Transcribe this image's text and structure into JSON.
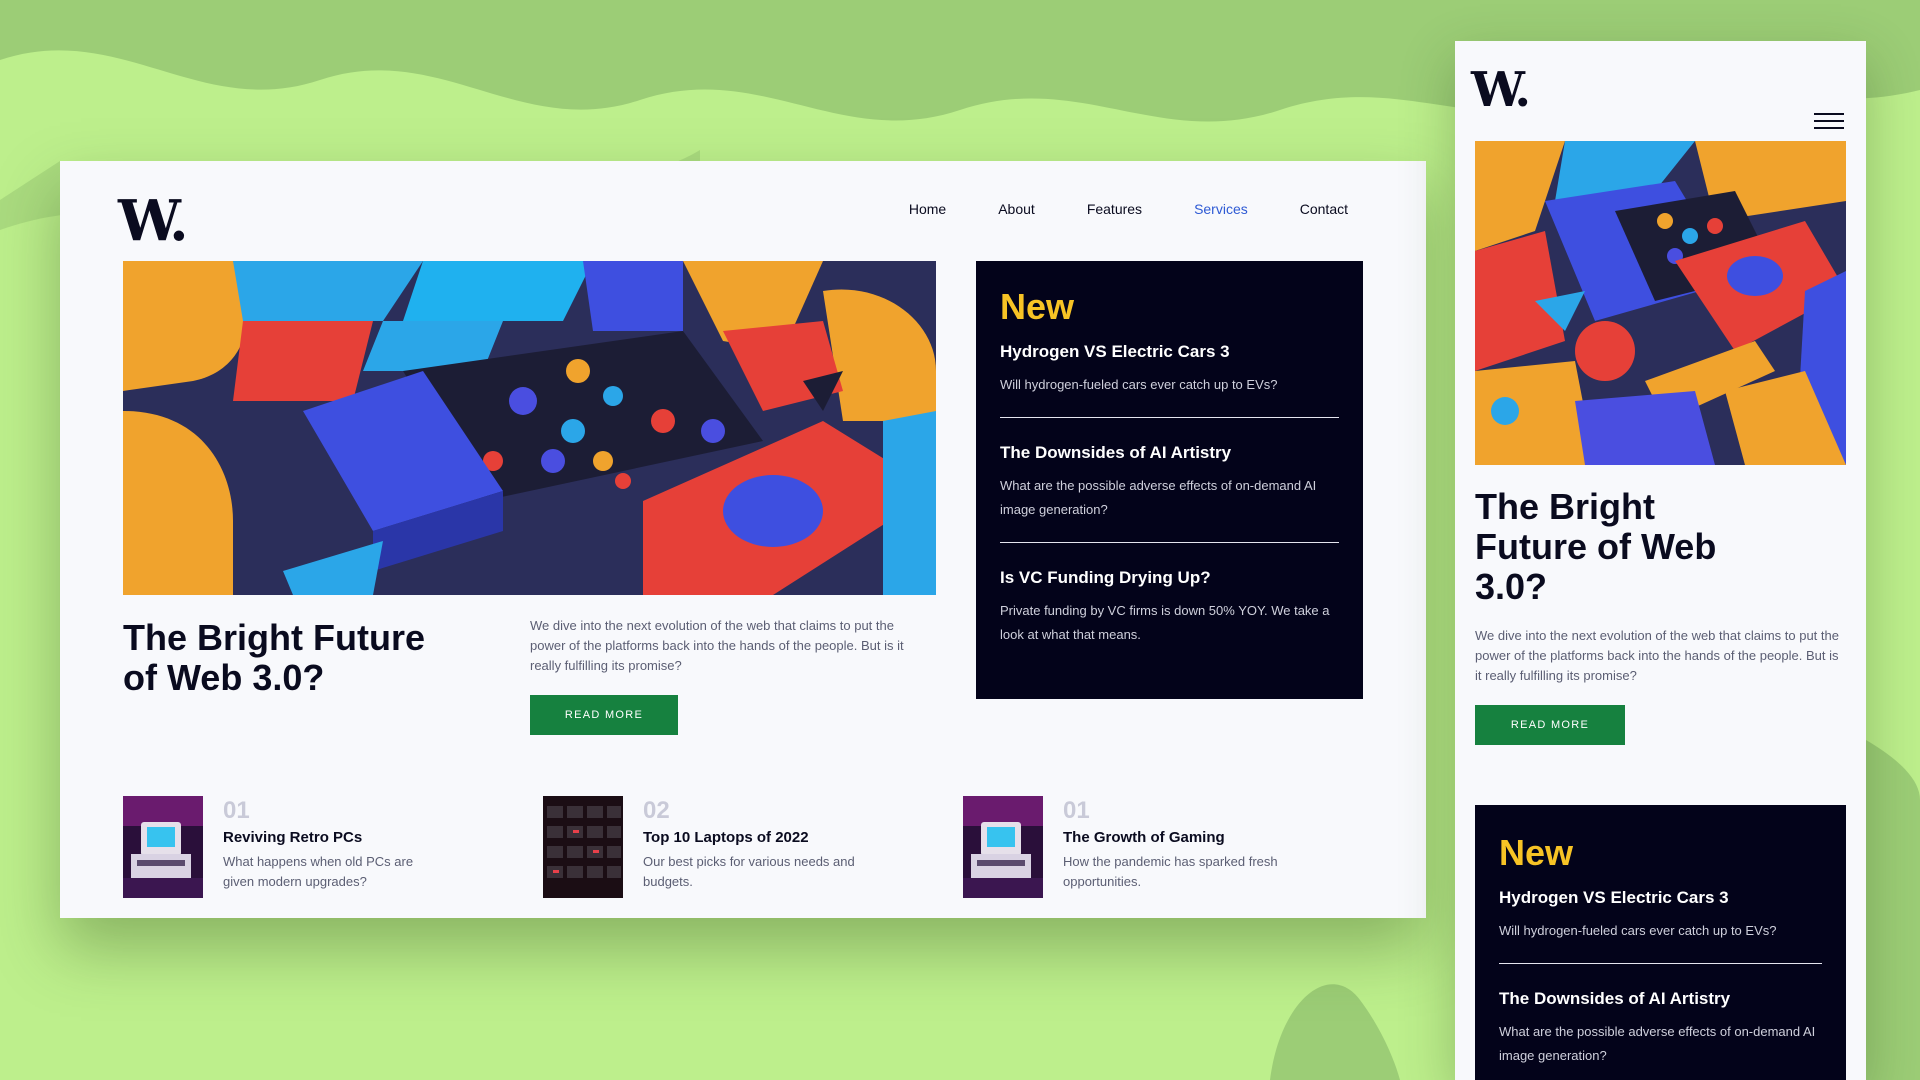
{
  "colors": {
    "background": "#bdef8c",
    "background_waves": "#9ccd76",
    "page": "#f8f9fc",
    "dark": "#0a0b1f",
    "panel": "#03031a",
    "accent_yellow": "#f7c325",
    "button_green": "#16813f",
    "active_link": "#2e5ad4"
  },
  "brand": {
    "logo": "W."
  },
  "nav": {
    "items": [
      "Home",
      "About",
      "Features",
      "Services",
      "Contact"
    ],
    "active": "Services"
  },
  "hero": {
    "title": "The Bright Future of Web 3.0?",
    "description": "We dive into the next evolution of the web that claims to put the power of the platforms back into the hands of the people. But is it really fulfilling its promise?",
    "button": "READ MORE"
  },
  "new_panel": {
    "heading": "New",
    "items": [
      {
        "title": "Hydrogen VS Electric Cars 3",
        "desc": "Will hydrogen-fueled cars ever catch up to EVs?"
      },
      {
        "title": "The Downsides of AI Artistry",
        "desc": "What are the possible adverse effects of on-demand AI image generation?"
      },
      {
        "title": "Is VC Funding Drying Up?",
        "desc": "Private funding by VC firms is down 50% YOY. We take a look at what that means."
      }
    ]
  },
  "articles": [
    {
      "num": "01",
      "title": "Reviving Retro PCs",
      "desc": "What happens when old PCs are given modern upgrades?",
      "thumb": "retro-pc-icon"
    },
    {
      "num": "02",
      "title": "Top 10 Laptops of 2022",
      "desc": "Our best picks for various needs and budgets.",
      "thumb": "keyboard-icon"
    },
    {
      "num": "01",
      "title": "The Growth of Gaming",
      "desc": "How the pandemic has sparked fresh opportunities.",
      "thumb": "retro-pc-icon"
    }
  ],
  "mobile": {
    "menu_icon": "hamburger-icon"
  }
}
